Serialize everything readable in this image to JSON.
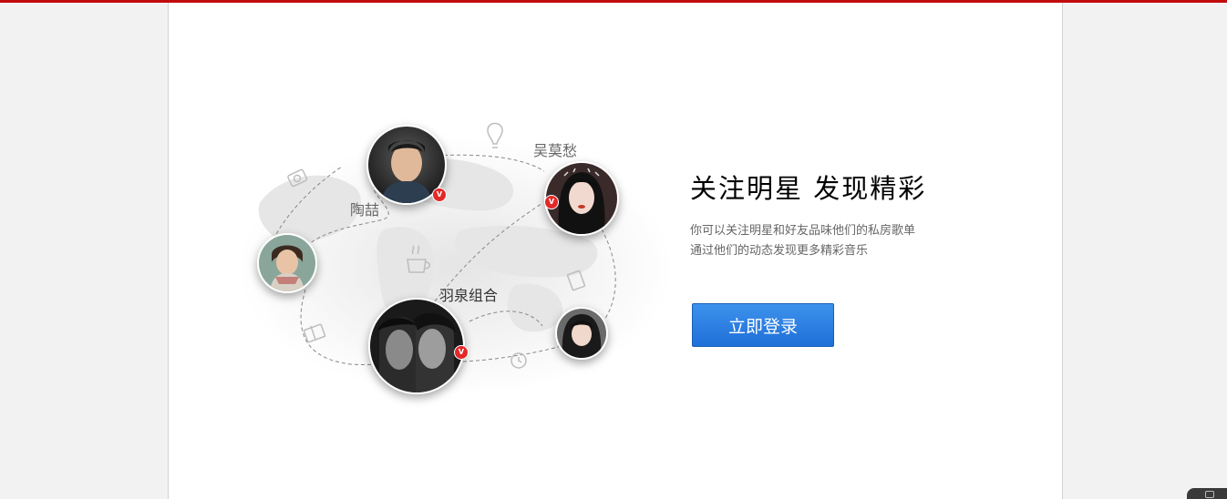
{
  "promo": {
    "headline": "关注明星 发现精彩",
    "description_line1": "你可以关注明星和好友品味他们的私房歌单",
    "description_line2": "通过他们的动态发现更多精彩音乐",
    "login_button": "立即登录"
  },
  "artists": [
    {
      "name": "陶喆",
      "verified": true
    },
    {
      "name": "吴莫愁",
      "verified": true
    },
    {
      "name": "羽泉组合",
      "verified": true
    }
  ],
  "badge_glyph": "V",
  "colors": {
    "top_bar": "#c20c0c",
    "button": "#2a7ee0",
    "badge": "#e32828"
  }
}
